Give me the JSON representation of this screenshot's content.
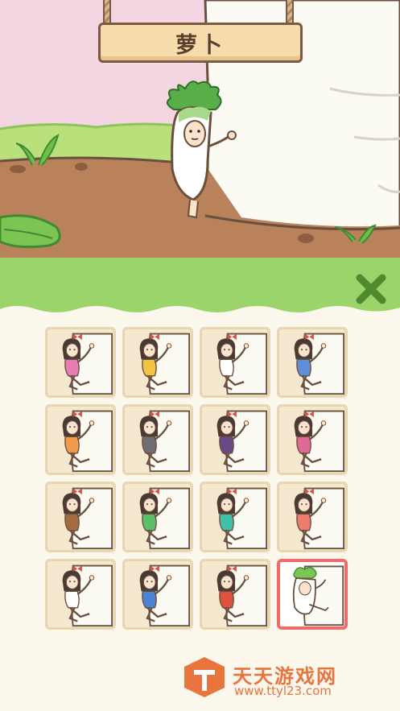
{
  "sign": {
    "label": "萝卜"
  },
  "grid": {
    "rows": 4,
    "columns": 4,
    "selected_index": 15,
    "items": [
      {
        "outfit": "pink-dress",
        "color": "#e67bb5"
      },
      {
        "outfit": "yellow-backpack",
        "color": "#f2c442"
      },
      {
        "outfit": "white-shirt",
        "color": "#ffffff"
      },
      {
        "outfit": "blue-polka",
        "color": "#5b8fd9"
      },
      {
        "outfit": "orange-basket",
        "color": "#f09a4a"
      },
      {
        "outfit": "grey-glasses",
        "color": "#6e6e74"
      },
      {
        "outfit": "purple-ninja",
        "color": "#6a4a86"
      },
      {
        "outfit": "pink-veggie-basket",
        "color": "#e06a94"
      },
      {
        "outfit": "brown-monkey",
        "color": "#a56a3e"
      },
      {
        "outfit": "red-beret",
        "color": "#5ac06a"
      },
      {
        "outfit": "teal-dress",
        "color": "#3fc2a8"
      },
      {
        "outfit": "coral-dress",
        "color": "#ef7a6e"
      },
      {
        "outfit": "straw-hat",
        "color": "#ffffff"
      },
      {
        "outfit": "yellow-melon",
        "color": "#4a84d6"
      },
      {
        "outfit": "red-qipao",
        "color": "#e0503e"
      },
      {
        "outfit": "radish-suit",
        "color": "#ffffff"
      }
    ]
  },
  "watermark": {
    "title": "天天游戏网",
    "url": "www.ttyl23.com"
  },
  "colors": {
    "banner_green": "#9bd46a",
    "selected_border": "#ef6a6a",
    "cell_bg": "#f4e9cf",
    "watermark_orange": "#e8753e"
  }
}
